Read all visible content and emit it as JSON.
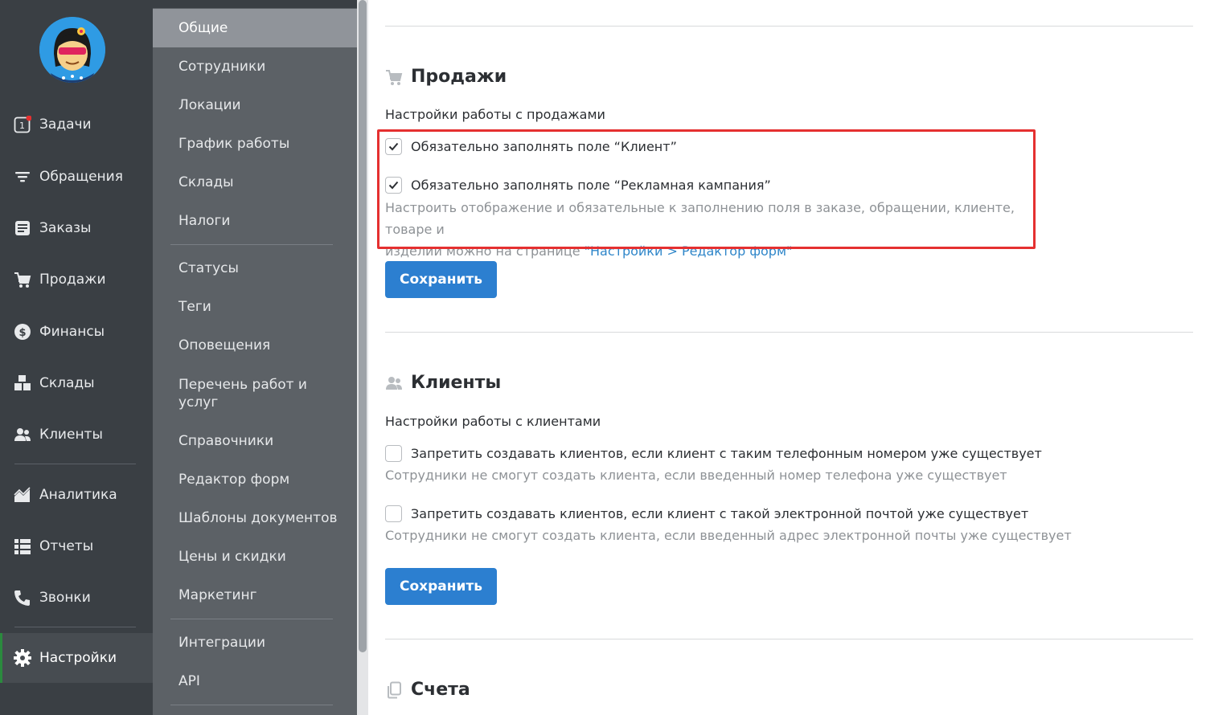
{
  "main_nav": {
    "items": [
      {
        "label": "Задачи",
        "icon": "tasks-icon",
        "badge_color": "#e53030"
      },
      {
        "label": "Обращения",
        "icon": "filter-icon"
      },
      {
        "label": "Заказы",
        "icon": "orders-icon"
      },
      {
        "label": "Продажи",
        "icon": "cart-icon"
      },
      {
        "label": "Финансы",
        "icon": "dollar-icon"
      },
      {
        "label": "Склады",
        "icon": "boxes-icon"
      },
      {
        "label": "Клиенты",
        "icon": "users-icon"
      },
      {
        "label": "Аналитика",
        "icon": "chart-icon"
      },
      {
        "label": "Отчеты",
        "icon": "list-icon"
      },
      {
        "label": "Звонки",
        "icon": "phone-icon"
      },
      {
        "label": "Настройки",
        "icon": "gear-icon",
        "active": true
      }
    ],
    "tasks_counter": "1"
  },
  "settings_nav": {
    "items": [
      {
        "label": "Общие",
        "active": true
      },
      {
        "label": "Сотрудники"
      },
      {
        "label": "Локации"
      },
      {
        "label": "График работы"
      },
      {
        "label": "Склады"
      },
      {
        "label": "Налоги"
      },
      {
        "label": "Статусы"
      },
      {
        "label": "Теги"
      },
      {
        "label": "Оповещения"
      },
      {
        "label": "Перечень работ и услуг"
      },
      {
        "label": "Справочники"
      },
      {
        "label": "Редактор форм"
      },
      {
        "label": "Шаблоны документов"
      },
      {
        "label": "Цены и скидки"
      },
      {
        "label": "Маркетинг"
      },
      {
        "label": "Интеграции"
      },
      {
        "label": "API"
      }
    ]
  },
  "sales": {
    "title": "Продажи",
    "description": "Настройки работы с продажами",
    "options": [
      {
        "label": "Обязательно заполнять поле “Клиент”",
        "checked": true
      },
      {
        "label": "Обязательно заполнять поле “Рекламная кампания”",
        "checked": true
      }
    ],
    "hint_line1": "Настроить отображение и обязательные к заполнению поля в заказе, обращении, клиенте, товаре и",
    "hint_line2": "изделии можно на странице ",
    "hint_link": "\"Настройки > Редактор форм\"",
    "save_label": "Сохранить"
  },
  "clients": {
    "title": "Клиенты",
    "description": "Настройки работы с клиентами",
    "options": [
      {
        "label": "Запретить создавать клиентов, если клиент с таким телефонным номером уже существует",
        "checked": false,
        "hint": "Сотрудники не смогут создать клиента, если введенный номер телефона уже существует"
      },
      {
        "label": "Запретить создавать клиентов, если клиент с такой электронной почтой уже существует",
        "checked": false,
        "hint": "Сотрудники не смогут создать клиента, если введенный адрес электронной почты уже существует"
      }
    ],
    "save_label": "Сохранить"
  },
  "invoices": {
    "title": "Счета"
  },
  "colors": {
    "primary_button": "#2c7fd0",
    "highlight_border": "#e53030",
    "link": "#2f86c9",
    "active_indicator": "#2b8a3e"
  }
}
